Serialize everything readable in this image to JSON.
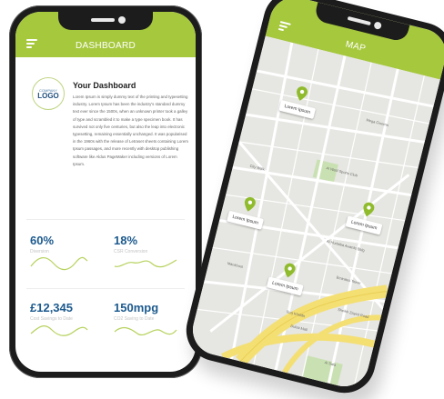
{
  "dashboard": {
    "header_title": "DASHBOARD",
    "logo_line1": "COMPANY",
    "logo_line2": "LOGO",
    "title": "Your Dashboard",
    "body": "Lorem Ipsum is simply dummy text of the printing and typesetting industry. Lorem Ipsum has been the industry's standard dummy text ever since the 1500s, when an unknown printer took a galley of type and scrambled it to make a type specimen book. It has survived not only five centuries, but also the leap into electronic typesetting, remaining essentially unchanged. It was popularised in the 1960s with the release of Letraset sheets containing Lorem Ipsum passages, and more recently with desktop publishing software like Aldus PageMaker including versions of Lorem Ipsum.",
    "stats": [
      {
        "value": "60%",
        "label": "Diversion"
      },
      {
        "value": "18%",
        "label": "CSR Conversion"
      },
      {
        "value": "£12,345",
        "label": "Cost Savings to Date"
      },
      {
        "value": "150mpg",
        "label": "CO2 Saving to Date"
      }
    ],
    "colors": {
      "accent": "#a6c83d",
      "value": "#1c5a8e"
    }
  },
  "map": {
    "header_title": "MAP",
    "pin_label": "Lorem Ipsum",
    "place_labels": [
      "Mega Cinema",
      "City Walk",
      "Al Wasl Sports Club",
      "Al Hudaiba Awards Bldg",
      "Emirates Tower",
      "Burj Khalifa",
      "Dubai Mall",
      "Sheikh Zayed Road",
      "Mankhool",
      "Al Safa"
    ]
  }
}
